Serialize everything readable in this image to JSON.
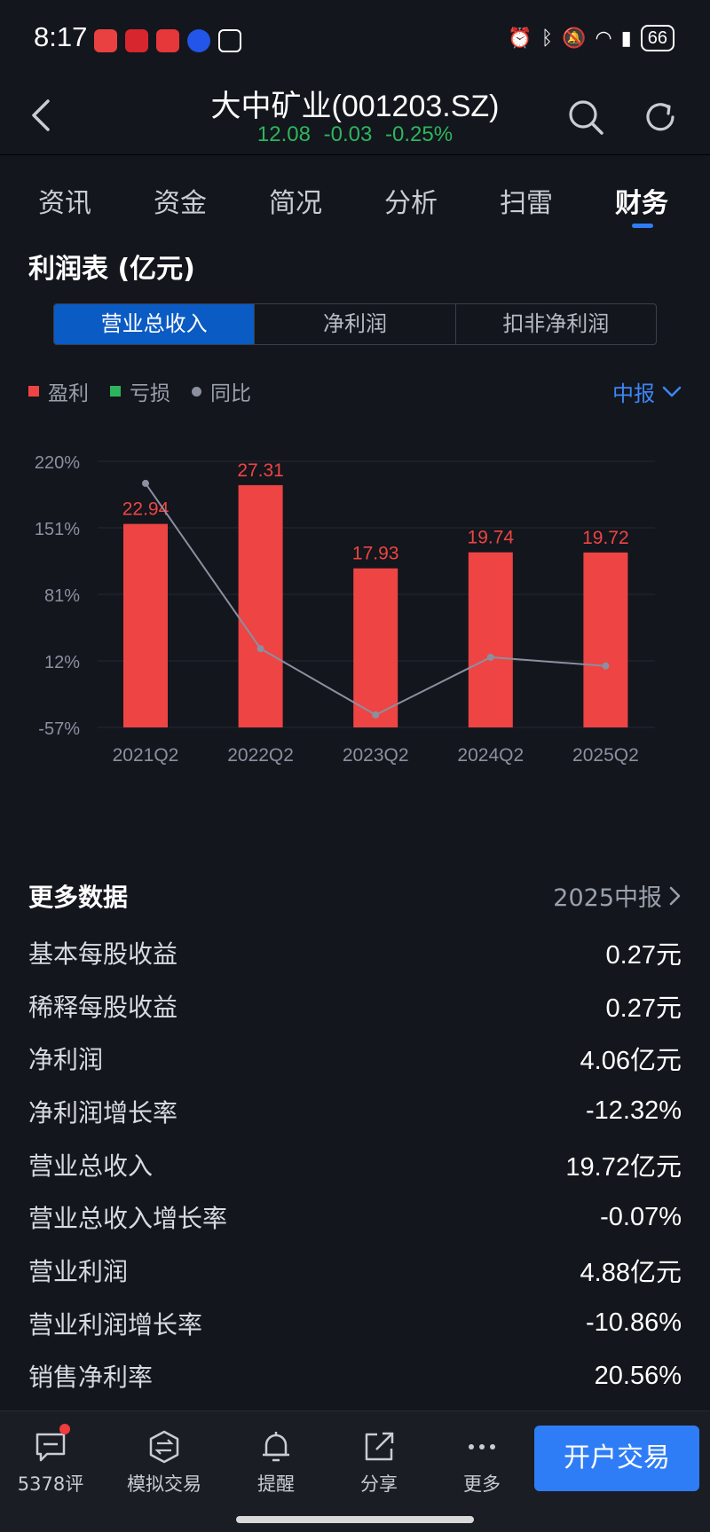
{
  "status_bar": {
    "time": "8:17",
    "battery": "66"
  },
  "header": {
    "title": "大中矿业(001203.SZ)",
    "price": "12.08",
    "change": "-0.03",
    "change_pct": "-0.25%",
    "quote_color": "#2db55d"
  },
  "tabs": [
    {
      "label": "资讯",
      "active": false
    },
    {
      "label": "资金",
      "active": false
    },
    {
      "label": "简况",
      "active": false
    },
    {
      "label": "分析",
      "active": false
    },
    {
      "label": "扫雷",
      "active": false
    },
    {
      "label": "财务",
      "active": true
    }
  ],
  "section_title": "利润表 (亿元)",
  "segments": [
    {
      "label": "营业总收入",
      "active": true
    },
    {
      "label": "净利润",
      "active": false
    },
    {
      "label": "扣非净利润",
      "active": false
    }
  ],
  "legend": {
    "profit": "盈利",
    "loss": "亏损",
    "yoy": "同比",
    "profit_color": "#ee4444",
    "loss_color": "#2db55d",
    "yoy_color": "#8a90a0"
  },
  "period_select": "中报",
  "chart_data": {
    "type": "bar",
    "categories": [
      "2021Q2",
      "2022Q2",
      "2023Q2",
      "2024Q2",
      "2025Q2"
    ],
    "series": [
      {
        "name": "盈利",
        "values": [
          22.94,
          27.31,
          17.93,
          19.74,
          19.72
        ],
        "color": "#ee4444"
      },
      {
        "name": "同比",
        "type": "line",
        "values": [
          197,
          25,
          -44,
          16,
          7
        ],
        "color": "#8a90a0"
      }
    ],
    "value_labels": [
      "22.94",
      "27.31",
      "17.93",
      "19.74",
      "19.72"
    ],
    "bar_ylim": [
      0,
      30
    ],
    "yoy_ylim": [
      -57,
      220
    ],
    "y_ticks": [
      "220%",
      "151%",
      "81%",
      "12%",
      "-57%"
    ],
    "grid": true
  },
  "more": {
    "title": "更多数据",
    "period": "2025中报",
    "rows": [
      {
        "label": "基本每股收益",
        "value": "0.27元"
      },
      {
        "label": "稀释每股收益",
        "value": "0.27元"
      },
      {
        "label": "净利润",
        "value": "4.06亿元"
      },
      {
        "label": "净利润增长率",
        "value": "-12.32%"
      },
      {
        "label": "营业总收入",
        "value": "19.72亿元"
      },
      {
        "label": "营业总收入增长率",
        "value": "-0.07%"
      },
      {
        "label": "营业利润",
        "value": "4.88亿元"
      },
      {
        "label": "营业利润增长率",
        "value": "-10.86%"
      },
      {
        "label": "销售净利率",
        "value": "20.56%"
      }
    ]
  },
  "bottom_nav": {
    "comments": "5378评",
    "simulate": "模拟交易",
    "remind": "提醒",
    "share": "分享",
    "more": "更多",
    "trade": "开户交易"
  }
}
